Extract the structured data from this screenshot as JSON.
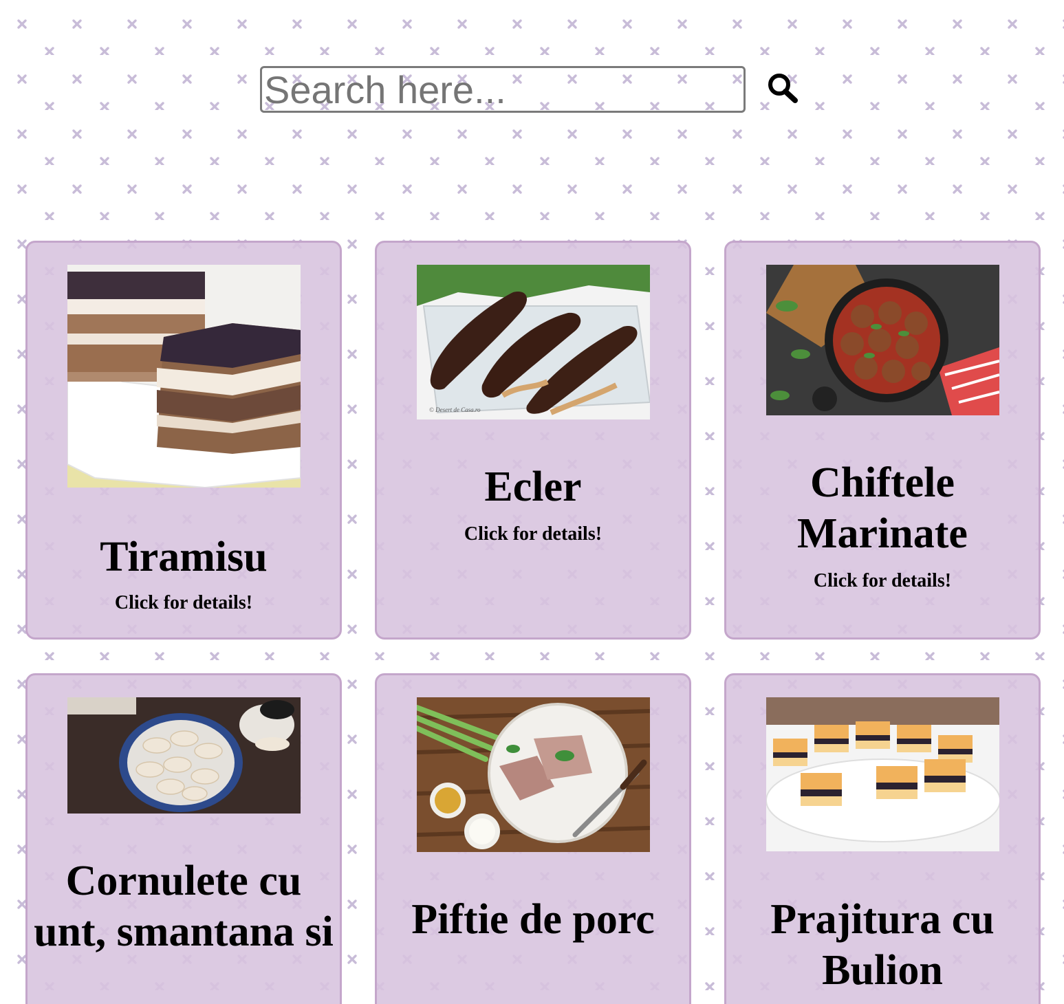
{
  "search": {
    "placeholder": "Search here...",
    "value": "",
    "icon": "search-icon"
  },
  "colors": {
    "background": "#ffffff",
    "pattern_x": "#c8bcd8",
    "card_fill": "#d7c3de",
    "card_border": "#c4a6cb"
  },
  "recipes": [
    {
      "title": "Tiramisu",
      "details_label": "Click for details!",
      "image": "tiramisu-photo"
    },
    {
      "title": "Ecler",
      "details_label": "Click for details!",
      "image": "eclair-photo",
      "image_caption": "© Desert de Casa.ro"
    },
    {
      "title": "Chiftele Marinate",
      "details_label": "Click for details!",
      "image": "meatballs-photo"
    },
    {
      "title": "Cornulete cu unt, smantana si",
      "details_label": "",
      "image": "cornulete-photo"
    },
    {
      "title": "Piftie de porc",
      "details_label": "",
      "image": "piftie-photo"
    },
    {
      "title": "Prajitura cu Bulion",
      "details_label": "",
      "image": "prajitura-photo"
    }
  ]
}
